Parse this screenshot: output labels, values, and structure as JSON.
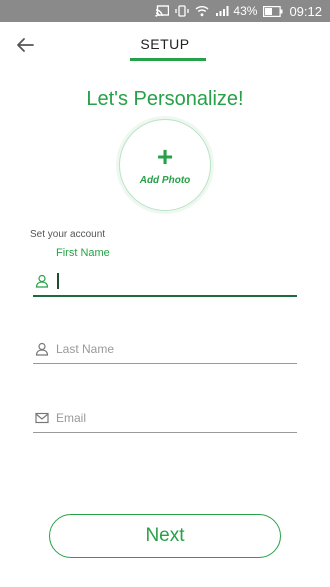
{
  "status_bar": {
    "battery_percent": "43%",
    "time": "09:12",
    "icons": [
      "cast-icon",
      "vibrate-icon",
      "wifi-icon",
      "signal-icon",
      "battery-icon"
    ]
  },
  "header": {
    "title": "SETUP",
    "back_icon": "arrow-left-icon"
  },
  "main": {
    "heading": "Let's Personalize!",
    "add_photo": {
      "plus": "+",
      "label": "Add Photo"
    },
    "section_label": "Set your account",
    "fields": [
      {
        "name": "first-name",
        "label": "First Name",
        "value": "",
        "placeholder": "",
        "icon": "user-icon",
        "active": true
      },
      {
        "name": "last-name",
        "label": "",
        "value": "",
        "placeholder": "Last Name",
        "icon": "user-icon",
        "active": false
      },
      {
        "name": "email",
        "label": "",
        "value": "",
        "placeholder": "Email",
        "icon": "mail-icon",
        "active": false
      }
    ],
    "next_label": "Next"
  },
  "colors": {
    "accent": "#27a147",
    "active_underline": "#1f6a3c",
    "status_bar": "#8a8a8a"
  }
}
